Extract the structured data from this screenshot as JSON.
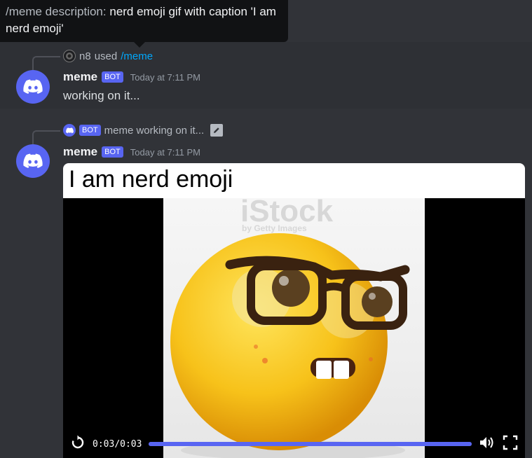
{
  "tooltip": {
    "key": "/meme description:",
    "value": "nerd emoji gif with caption 'I am nerd emoji'"
  },
  "messages": [
    {
      "reply": {
        "user": "n8",
        "used": "used",
        "command": "/meme"
      },
      "author": "meme",
      "tag": "BOT",
      "timestamp": "Today at 7:11 PM",
      "content": "working on it..."
    },
    {
      "reply": {
        "tag": "BOT",
        "text": "meme working on it..."
      },
      "author": "meme",
      "tag": "BOT",
      "timestamp": "Today at 7:11 PM",
      "embed": {
        "caption": "I am nerd emoji",
        "current_time": "0:03",
        "separator": "/",
        "duration": "0:03",
        "progress": 1.0,
        "watermark_text": "iStock",
        "watermark_sub": "by Getty Images"
      }
    }
  ],
  "colors": {
    "blurple": "#5865f2",
    "link": "#00a8fc",
    "background": "#313338"
  }
}
